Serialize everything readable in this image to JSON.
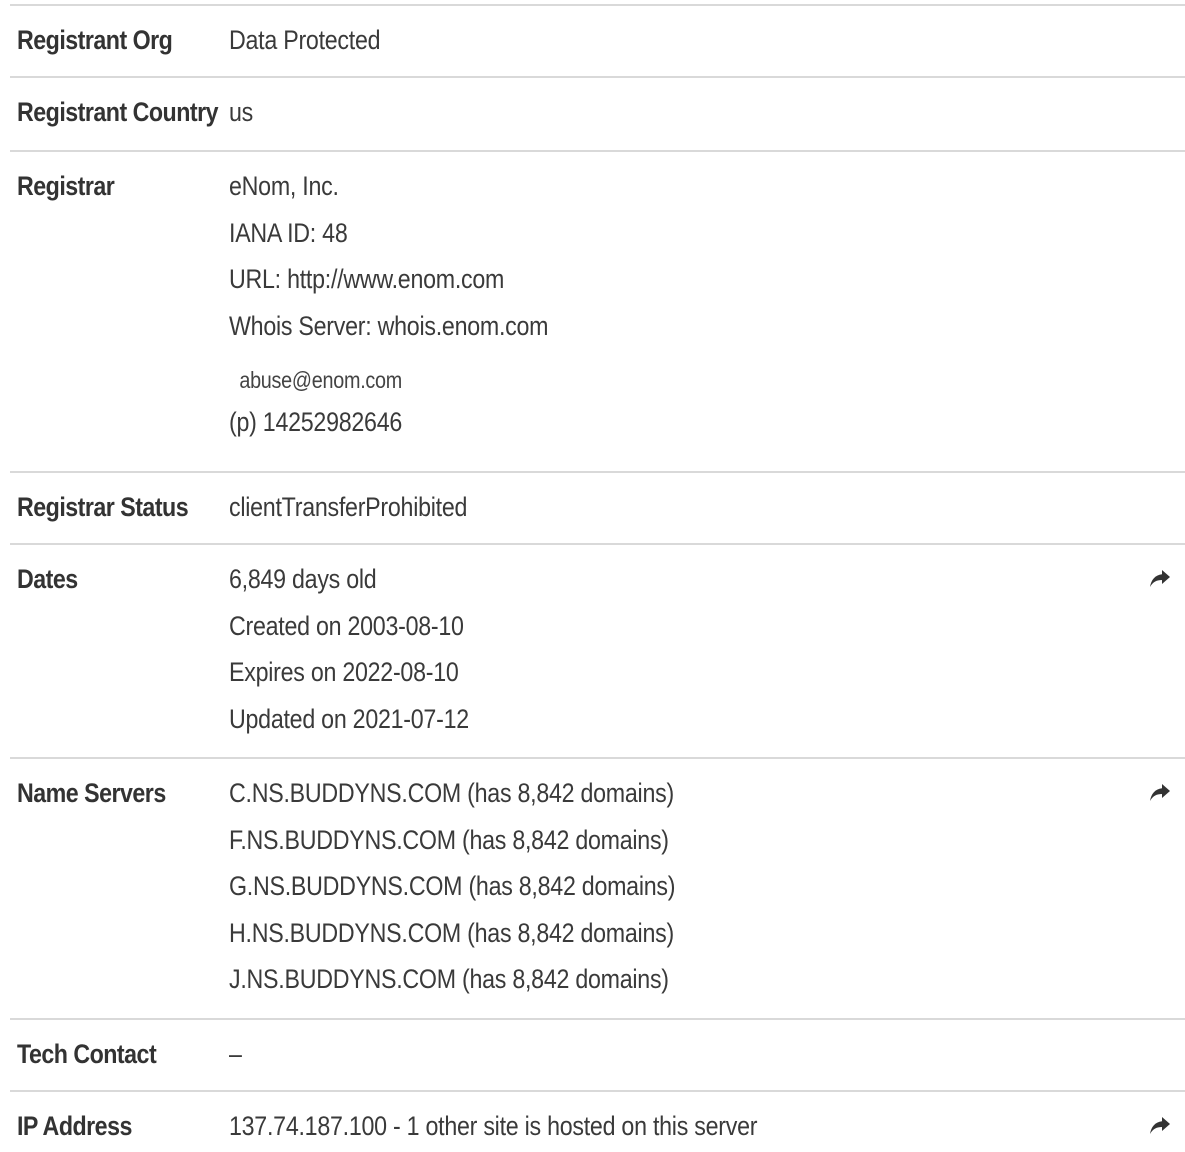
{
  "rows": {
    "registrant_org": {
      "label": "Registrant Org",
      "value": "Data Protected"
    },
    "registrant_country": {
      "label": "Registrant Country",
      "value": "us"
    },
    "registrar": {
      "label": "Registrar",
      "name": "eNom, Inc.",
      "iana": "IANA ID: 48",
      "url": "URL: http://www.enom.com",
      "whois": "Whois Server: whois.enom.com",
      "email": "abuse@enom.com",
      "phone": "(p) 14252982646"
    },
    "registrar_status": {
      "label": "Registrar Status",
      "value": "clientTransferProhibited"
    },
    "dates": {
      "label": "Dates",
      "age": "6,849 days old",
      "created": "Created on 2003-08-10",
      "expires": "Expires on 2022-08-10",
      "updated": "Updated on 2021-07-12",
      "icon": "share-arrow-icon"
    },
    "name_servers": {
      "label": "Name Servers",
      "servers": [
        "C.NS.BUDDYNS.COM (has 8,842 domains)",
        "F.NS.BUDDYNS.COM (has 8,842 domains)",
        "G.NS.BUDDYNS.COM (has 8,842 domains)",
        "H.NS.BUDDYNS.COM (has 8,842 domains)",
        "J.NS.BUDDYNS.COM (has 8,842 domains)"
      ],
      "icon": "share-arrow-icon"
    },
    "tech_contact": {
      "label": "Tech Contact",
      "value": "–"
    },
    "ip_address": {
      "label": "IP Address",
      "value": "137.74.187.100 - 1 other site is hosted on this server",
      "icon": "share-arrow-icon"
    }
  }
}
